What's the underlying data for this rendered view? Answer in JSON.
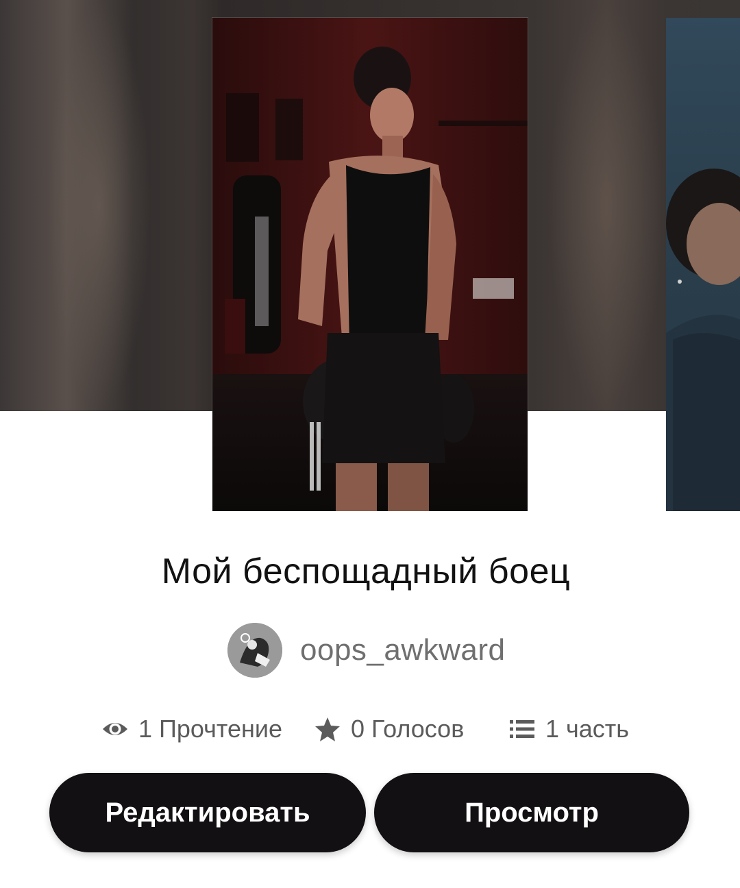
{
  "story": {
    "title": "Мой беспощадный боец",
    "author": "oops_awkward"
  },
  "stats": {
    "reads": "1 Прочтение",
    "votes": "0 Голосов",
    "parts": "1 часть"
  },
  "actions": {
    "edit_label": "Редактировать",
    "view_label": "Просмотр"
  },
  "icons": {
    "reads": "eye-icon",
    "votes": "star-icon",
    "parts": "list-icon"
  }
}
